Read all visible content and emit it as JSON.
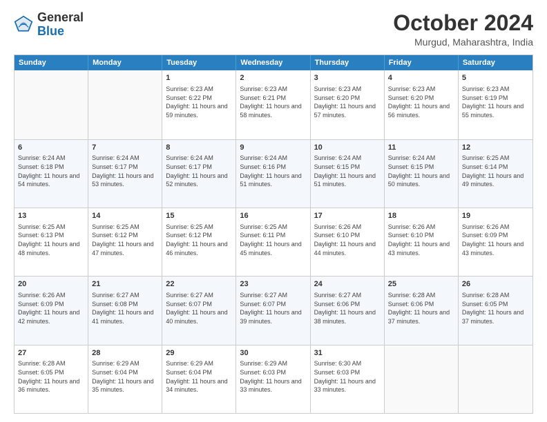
{
  "logo": {
    "general": "General",
    "blue": "Blue"
  },
  "title": "October 2024",
  "location": "Murgud, Maharashtra, India",
  "headers": [
    "Sunday",
    "Monday",
    "Tuesday",
    "Wednesday",
    "Thursday",
    "Friday",
    "Saturday"
  ],
  "weeks": [
    [
      {
        "day": "",
        "sunrise": "",
        "sunset": "",
        "daylight": "",
        "empty": true
      },
      {
        "day": "",
        "sunrise": "",
        "sunset": "",
        "daylight": "",
        "empty": true
      },
      {
        "day": "1",
        "sunrise": "Sunrise: 6:23 AM",
        "sunset": "Sunset: 6:22 PM",
        "daylight": "Daylight: 11 hours and 59 minutes."
      },
      {
        "day": "2",
        "sunrise": "Sunrise: 6:23 AM",
        "sunset": "Sunset: 6:21 PM",
        "daylight": "Daylight: 11 hours and 58 minutes."
      },
      {
        "day": "3",
        "sunrise": "Sunrise: 6:23 AM",
        "sunset": "Sunset: 6:20 PM",
        "daylight": "Daylight: 11 hours and 57 minutes."
      },
      {
        "day": "4",
        "sunrise": "Sunrise: 6:23 AM",
        "sunset": "Sunset: 6:20 PM",
        "daylight": "Daylight: 11 hours and 56 minutes."
      },
      {
        "day": "5",
        "sunrise": "Sunrise: 6:23 AM",
        "sunset": "Sunset: 6:19 PM",
        "daylight": "Daylight: 11 hours and 55 minutes."
      }
    ],
    [
      {
        "day": "6",
        "sunrise": "Sunrise: 6:24 AM",
        "sunset": "Sunset: 6:18 PM",
        "daylight": "Daylight: 11 hours and 54 minutes."
      },
      {
        "day": "7",
        "sunrise": "Sunrise: 6:24 AM",
        "sunset": "Sunset: 6:17 PM",
        "daylight": "Daylight: 11 hours and 53 minutes."
      },
      {
        "day": "8",
        "sunrise": "Sunrise: 6:24 AM",
        "sunset": "Sunset: 6:17 PM",
        "daylight": "Daylight: 11 hours and 52 minutes."
      },
      {
        "day": "9",
        "sunrise": "Sunrise: 6:24 AM",
        "sunset": "Sunset: 6:16 PM",
        "daylight": "Daylight: 11 hours and 51 minutes."
      },
      {
        "day": "10",
        "sunrise": "Sunrise: 6:24 AM",
        "sunset": "Sunset: 6:15 PM",
        "daylight": "Daylight: 11 hours and 51 minutes."
      },
      {
        "day": "11",
        "sunrise": "Sunrise: 6:24 AM",
        "sunset": "Sunset: 6:15 PM",
        "daylight": "Daylight: 11 hours and 50 minutes."
      },
      {
        "day": "12",
        "sunrise": "Sunrise: 6:25 AM",
        "sunset": "Sunset: 6:14 PM",
        "daylight": "Daylight: 11 hours and 49 minutes."
      }
    ],
    [
      {
        "day": "13",
        "sunrise": "Sunrise: 6:25 AM",
        "sunset": "Sunset: 6:13 PM",
        "daylight": "Daylight: 11 hours and 48 minutes."
      },
      {
        "day": "14",
        "sunrise": "Sunrise: 6:25 AM",
        "sunset": "Sunset: 6:12 PM",
        "daylight": "Daylight: 11 hours and 47 minutes."
      },
      {
        "day": "15",
        "sunrise": "Sunrise: 6:25 AM",
        "sunset": "Sunset: 6:12 PM",
        "daylight": "Daylight: 11 hours and 46 minutes."
      },
      {
        "day": "16",
        "sunrise": "Sunrise: 6:25 AM",
        "sunset": "Sunset: 6:11 PM",
        "daylight": "Daylight: 11 hours and 45 minutes."
      },
      {
        "day": "17",
        "sunrise": "Sunrise: 6:26 AM",
        "sunset": "Sunset: 6:10 PM",
        "daylight": "Daylight: 11 hours and 44 minutes."
      },
      {
        "day": "18",
        "sunrise": "Sunrise: 6:26 AM",
        "sunset": "Sunset: 6:10 PM",
        "daylight": "Daylight: 11 hours and 43 minutes."
      },
      {
        "day": "19",
        "sunrise": "Sunrise: 6:26 AM",
        "sunset": "Sunset: 6:09 PM",
        "daylight": "Daylight: 11 hours and 43 minutes."
      }
    ],
    [
      {
        "day": "20",
        "sunrise": "Sunrise: 6:26 AM",
        "sunset": "Sunset: 6:09 PM",
        "daylight": "Daylight: 11 hours and 42 minutes."
      },
      {
        "day": "21",
        "sunrise": "Sunrise: 6:27 AM",
        "sunset": "Sunset: 6:08 PM",
        "daylight": "Daylight: 11 hours and 41 minutes."
      },
      {
        "day": "22",
        "sunrise": "Sunrise: 6:27 AM",
        "sunset": "Sunset: 6:07 PM",
        "daylight": "Daylight: 11 hours and 40 minutes."
      },
      {
        "day": "23",
        "sunrise": "Sunrise: 6:27 AM",
        "sunset": "Sunset: 6:07 PM",
        "daylight": "Daylight: 11 hours and 39 minutes."
      },
      {
        "day": "24",
        "sunrise": "Sunrise: 6:27 AM",
        "sunset": "Sunset: 6:06 PM",
        "daylight": "Daylight: 11 hours and 38 minutes."
      },
      {
        "day": "25",
        "sunrise": "Sunrise: 6:28 AM",
        "sunset": "Sunset: 6:06 PM",
        "daylight": "Daylight: 11 hours and 37 minutes."
      },
      {
        "day": "26",
        "sunrise": "Sunrise: 6:28 AM",
        "sunset": "Sunset: 6:05 PM",
        "daylight": "Daylight: 11 hours and 37 minutes."
      }
    ],
    [
      {
        "day": "27",
        "sunrise": "Sunrise: 6:28 AM",
        "sunset": "Sunset: 6:05 PM",
        "daylight": "Daylight: 11 hours and 36 minutes."
      },
      {
        "day": "28",
        "sunrise": "Sunrise: 6:29 AM",
        "sunset": "Sunset: 6:04 PM",
        "daylight": "Daylight: 11 hours and 35 minutes."
      },
      {
        "day": "29",
        "sunrise": "Sunrise: 6:29 AM",
        "sunset": "Sunset: 6:04 PM",
        "daylight": "Daylight: 11 hours and 34 minutes."
      },
      {
        "day": "30",
        "sunrise": "Sunrise: 6:29 AM",
        "sunset": "Sunset: 6:03 PM",
        "daylight": "Daylight: 11 hours and 33 minutes."
      },
      {
        "day": "31",
        "sunrise": "Sunrise: 6:30 AM",
        "sunset": "Sunset: 6:03 PM",
        "daylight": "Daylight: 11 hours and 33 minutes."
      },
      {
        "day": "",
        "sunrise": "",
        "sunset": "",
        "daylight": "",
        "empty": true
      },
      {
        "day": "",
        "sunrise": "",
        "sunset": "",
        "daylight": "",
        "empty": true
      }
    ]
  ]
}
